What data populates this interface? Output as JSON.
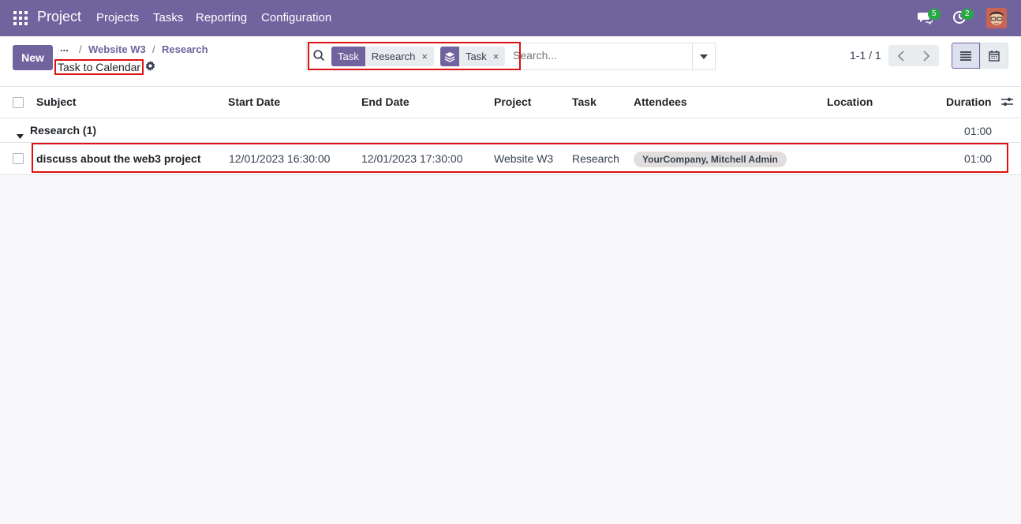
{
  "navbar": {
    "brand": "Project",
    "menus": [
      "Projects",
      "Tasks",
      "Reporting",
      "Configuration"
    ],
    "messages_badge": "5",
    "activities_badge": "2"
  },
  "control_panel": {
    "new_label": "New",
    "breadcrumb": {
      "ellipsis": "...",
      "items": [
        "Website W3",
        "Research"
      ],
      "separator": "/"
    },
    "view_title": "Task to Calendar",
    "search": {
      "facets": [
        {
          "label": "Task",
          "value": "Research"
        },
        {
          "label_icon": "layers-icon",
          "value": "Task"
        }
      ],
      "placeholder": "Search..."
    },
    "pager": "1-1 / 1"
  },
  "table": {
    "columns": [
      "Subject",
      "Start Date",
      "End Date",
      "Project",
      "Task",
      "Attendees",
      "Location",
      "Duration"
    ],
    "group": {
      "label": "Research (1)",
      "duration": "01:00"
    },
    "rows": [
      {
        "subject": "discuss about the web3 project",
        "start_date": "12/01/2023 16:30:00",
        "end_date": "12/01/2023 17:30:00",
        "project": "Website W3",
        "task": "Research",
        "attendees": "YourCompany, Mitchell Admin",
        "location": "",
        "duration": "01:00"
      }
    ]
  },
  "colors": {
    "brand": "#71639e",
    "highlight": "#dd1111",
    "badge": "#28a745"
  }
}
